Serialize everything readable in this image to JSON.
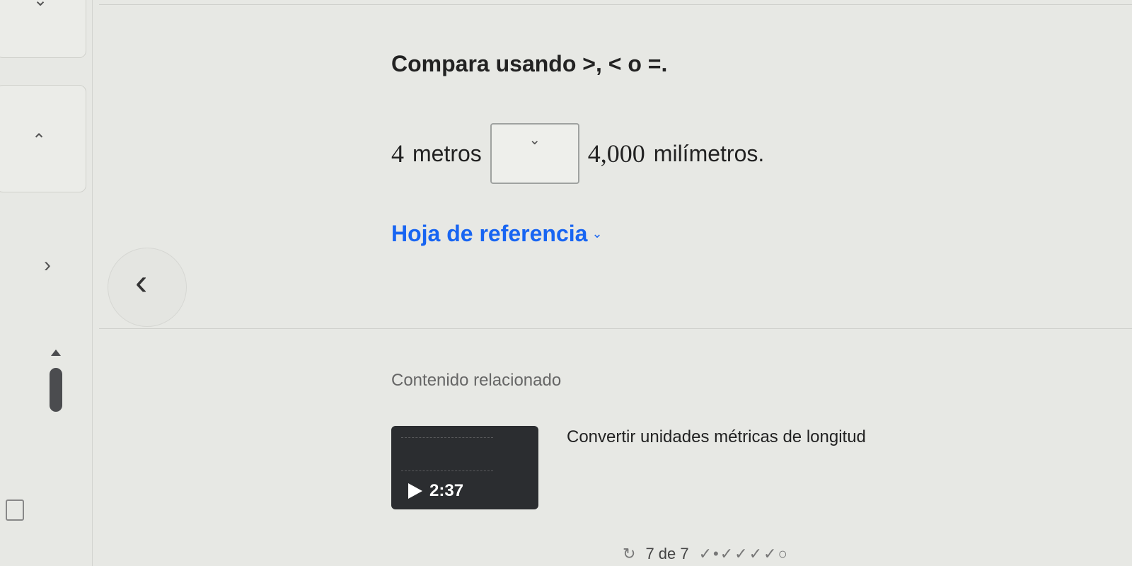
{
  "question": {
    "title": "Compara usando >, < o =."
  },
  "problem": {
    "left_value": "4",
    "left_unit": "metros",
    "dropdown_selected": "",
    "right_value": "4,000",
    "right_unit": "milímetros."
  },
  "reference": {
    "label": "Hoja de referencia"
  },
  "related": {
    "section_label": "Contenido relacionado",
    "video": {
      "title": "Convertir unidades métricas de longitud",
      "duration": "2:37"
    }
  },
  "footer": {
    "progress_text": "7 de 7",
    "progress_marks": "✓•✓✓✓✓○"
  },
  "icons": {
    "dropdown": "chevron-down-icon",
    "reference": "chevron-down-icon",
    "play": "play-icon",
    "prev": "chevron-left-icon"
  },
  "colors": {
    "link": "#1865f2",
    "background": "#e7e8e4",
    "thumbnail": "#2b2d30"
  }
}
